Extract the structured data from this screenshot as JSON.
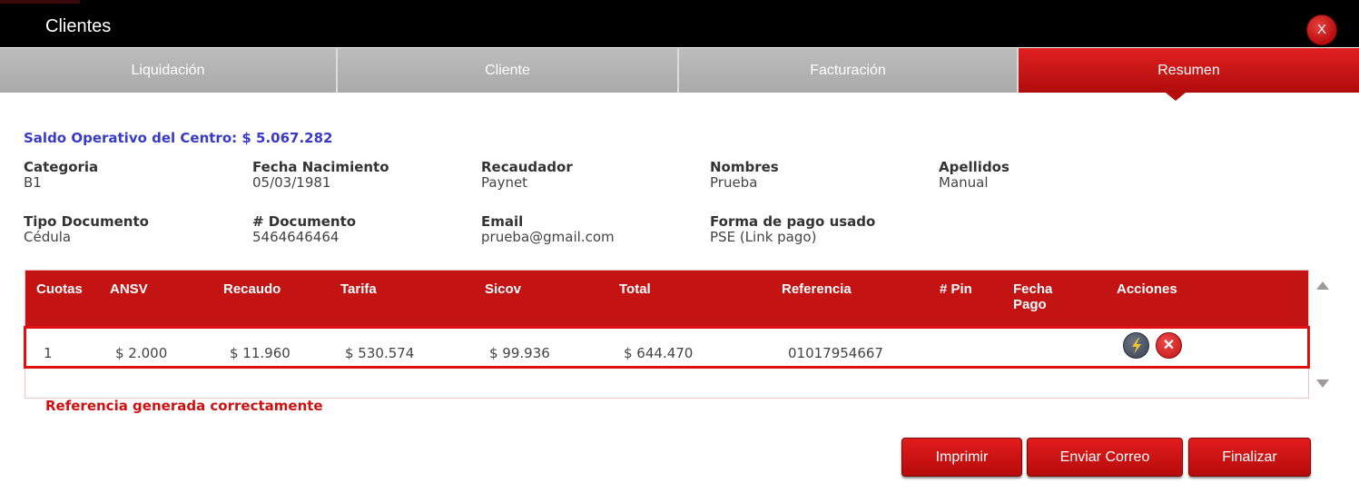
{
  "window": {
    "title": "Clientes",
    "close_label": "X"
  },
  "tabs": [
    {
      "label": "Liquidación",
      "active": false
    },
    {
      "label": "Cliente",
      "active": false
    },
    {
      "label": "Facturación",
      "active": false
    },
    {
      "label": "Resumen",
      "active": true
    }
  ],
  "saldo": "Saldo Operativo del Centro: $ 5.067.282",
  "fields": {
    "categoria": {
      "label": "Categoria",
      "value": "B1"
    },
    "fecha_nacimiento": {
      "label": "Fecha Nacimiento",
      "value": "05/03/1981"
    },
    "recaudador": {
      "label": "Recaudador",
      "value": "Paynet"
    },
    "nombres": {
      "label": "Nombres",
      "value": "Prueba"
    },
    "apellidos": {
      "label": "Apellidos",
      "value": "Manual"
    },
    "tipo_documento": {
      "label": "Tipo Documento",
      "value": "Cédula"
    },
    "documento": {
      "label": "# Documento",
      "value": "5464646464"
    },
    "email": {
      "label": "Email",
      "value": "prueba@gmail.com"
    },
    "forma_pago": {
      "label": "Forma de pago usado",
      "value": "PSE (Link pago)"
    }
  },
  "table": {
    "headers": {
      "cuotas": "Cuotas",
      "ansv": "ANSV",
      "recaudo": "Recaudo",
      "tarifa": "Tarifa",
      "sicov": "Sicov",
      "total": "Total",
      "referencia": "Referencia",
      "pin": "# Pin",
      "fecha_pago_1": "Fecha",
      "fecha_pago_2": "Pago",
      "acciones": "Acciones"
    },
    "rows": [
      {
        "cuotas": "1",
        "ansv": "$ 2.000",
        "recaudo": "$ 11.960",
        "tarifa": "$ 530.574",
        "sicov": "$ 99.936",
        "total": "$ 644.470",
        "referencia": "01017954667",
        "pin": "",
        "fecha_pago": "",
        "actions": [
          "bolt-icon",
          "cancel-icon"
        ]
      }
    ]
  },
  "message": "Referencia generada correctamente",
  "buttons": {
    "imprimir": "Imprimir",
    "enviar_correo": "Enviar Correo",
    "finalizar": "Finalizar"
  },
  "colors": {
    "primary_red": "#c31313",
    "title_bar": "#000000",
    "tab_inactive": "#b3b3b3",
    "saldo_text": "#3a3ac8"
  }
}
